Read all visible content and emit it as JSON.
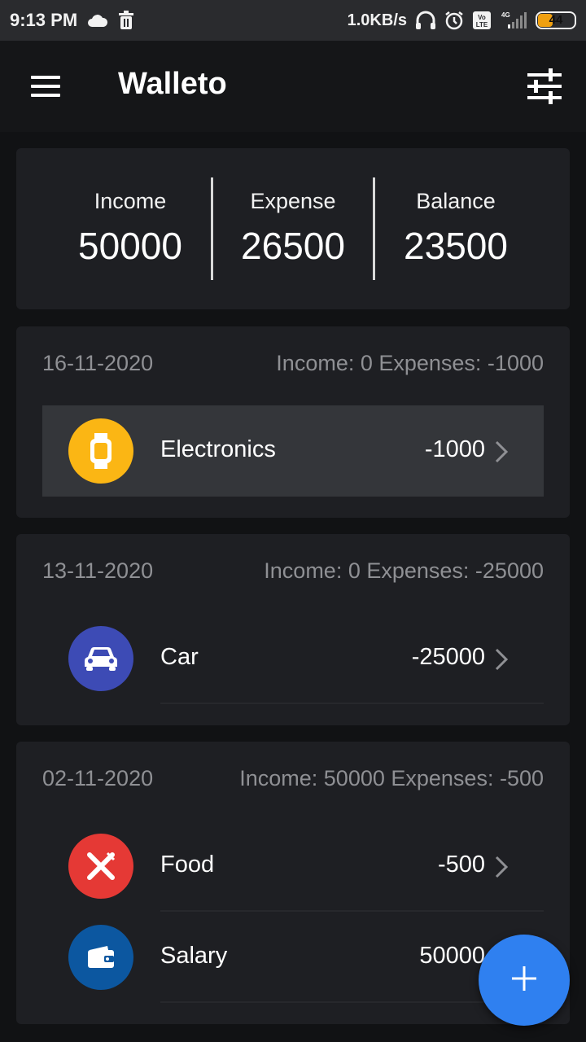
{
  "status_bar": {
    "time": "9:13 PM",
    "network_speed": "1.0KB/s",
    "lte_label": "Vo LTE",
    "signal_label": "4G",
    "battery_level": "44",
    "icons": [
      "cloud-icon",
      "trash-icon",
      "headset-icon",
      "alarm-icon",
      "volte-icon",
      "signal-icon",
      "battery-icon"
    ]
  },
  "app_bar": {
    "title": "Walleto",
    "menu_icon": "hamburger-menu-icon",
    "filter_icon": "sliders-filter-icon"
  },
  "summary": {
    "income_label": "Income",
    "income_value": "50000",
    "expense_label": "Expense",
    "expense_value": "26500",
    "balance_label": "Balance",
    "balance_value": "23500"
  },
  "days": [
    {
      "date": "16-11-2020",
      "totals": "Income: 0 Expenses: -1000",
      "transactions": [
        {
          "category": "Electronics",
          "amount": "-1000",
          "icon": "watch-icon",
          "color": "#fbb614"
        }
      ]
    },
    {
      "date": "13-11-2020",
      "totals": "Income: 0 Expenses: -25000",
      "transactions": [
        {
          "category": "Car",
          "amount": "-25000",
          "icon": "car-icon",
          "color": "#3d4bb5"
        }
      ]
    },
    {
      "date": "02-11-2020",
      "totals": "Income: 50000 Expenses: -500",
      "transactions": [
        {
          "category": "Food",
          "amount": "-500",
          "icon": "fork-knife-icon",
          "color": "#e53935"
        },
        {
          "category": "Salary",
          "amount": "50000",
          "icon": "wallet-icon",
          "color": "#0c57a0"
        }
      ]
    }
  ],
  "fab": {
    "icon": "plus-icon",
    "color": "#2f80f0"
  },
  "colors": {
    "background": "#111214",
    "card": "#1e1f23",
    "muted_text": "#8f9094"
  }
}
